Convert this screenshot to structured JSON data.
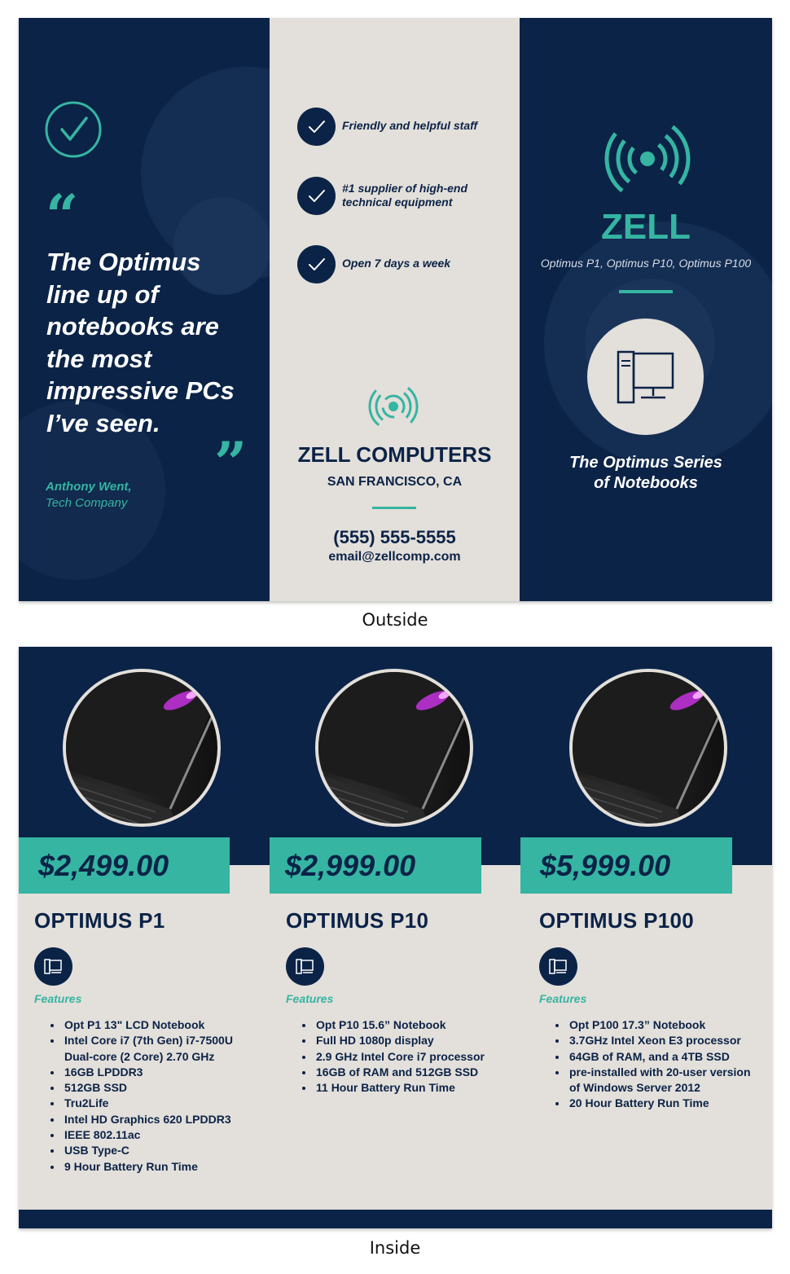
{
  "outside": {
    "caption": "Outside",
    "quote": {
      "text": "The Optimus line up of notebooks are the most impressive PCs I’ve seen.",
      "open_mark": "“",
      "close_mark": "”",
      "author_name": "Anthony Went,",
      "author_company": "Tech Company"
    },
    "features": [
      {
        "line1": "Friendly and helpful staff",
        "line2": ""
      },
      {
        "line1": "#1 supplier of high-end",
        "line2": "technical equipment"
      },
      {
        "line1": "Open 7 days a week",
        "line2": ""
      }
    ],
    "company": {
      "name": "ZELL COMPUTERS",
      "location": "SAN FRANCISCO, CA",
      "phone": "(555) 555-5555",
      "email": "email@zellcomp.com"
    },
    "cover": {
      "brand": "ZELL",
      "models": "Optimus P1, Optimus P10, Optimus P100",
      "series_line1": "The Optimus Series",
      "series_line2": "of Notebooks"
    },
    "icons": [
      "check-circle-icon",
      "broadcast-icon",
      "computer-icon",
      "check-icon"
    ]
  },
  "inside": {
    "caption": "Inside",
    "products": [
      {
        "price": "$2,499.00",
        "name": "OPTIMUS P1",
        "features_label": "Features",
        "features": [
          "Opt P1 13\" LCD Notebook",
          "Intel Core i7 (7th Gen) i7-7500U Dual-core (2 Core) 2.70 GHz",
          "16GB LPDDR3",
          "512GB SSD",
          "Tru2Life",
          "Intel HD Graphics 620 LPDDR3",
          "IEEE 802.11ac",
          "USB Type-C",
          "9 Hour Battery Run Time"
        ]
      },
      {
        "price": "$2,999.00",
        "name": "OPTIMUS P10",
        "features_label": "Features",
        "features": [
          "Opt P10 15.6” Notebook",
          "Full HD 1080p display",
          "2.9 GHz Intel Core i7 processor",
          "16GB of RAM and 512GB SSD",
          "11 Hour Battery Run Time"
        ]
      },
      {
        "price": "$5,999.00",
        "name": "OPTIMUS P100",
        "features_label": "Features",
        "features": [
          "Opt P100 17.3” Notebook",
          "3.7GHz Intel Xeon E3 processor",
          "64GB of RAM, and a 4TB SSD",
          "pre-installed with 20-user version of Windows Server 2012",
          "20 Hour Battery Run Time"
        ]
      }
    ]
  },
  "colors": {
    "navy": "#0b2347",
    "teal": "#35b5a2",
    "sand": "#e3dfda",
    "laptop_glow": "#c531e0"
  }
}
